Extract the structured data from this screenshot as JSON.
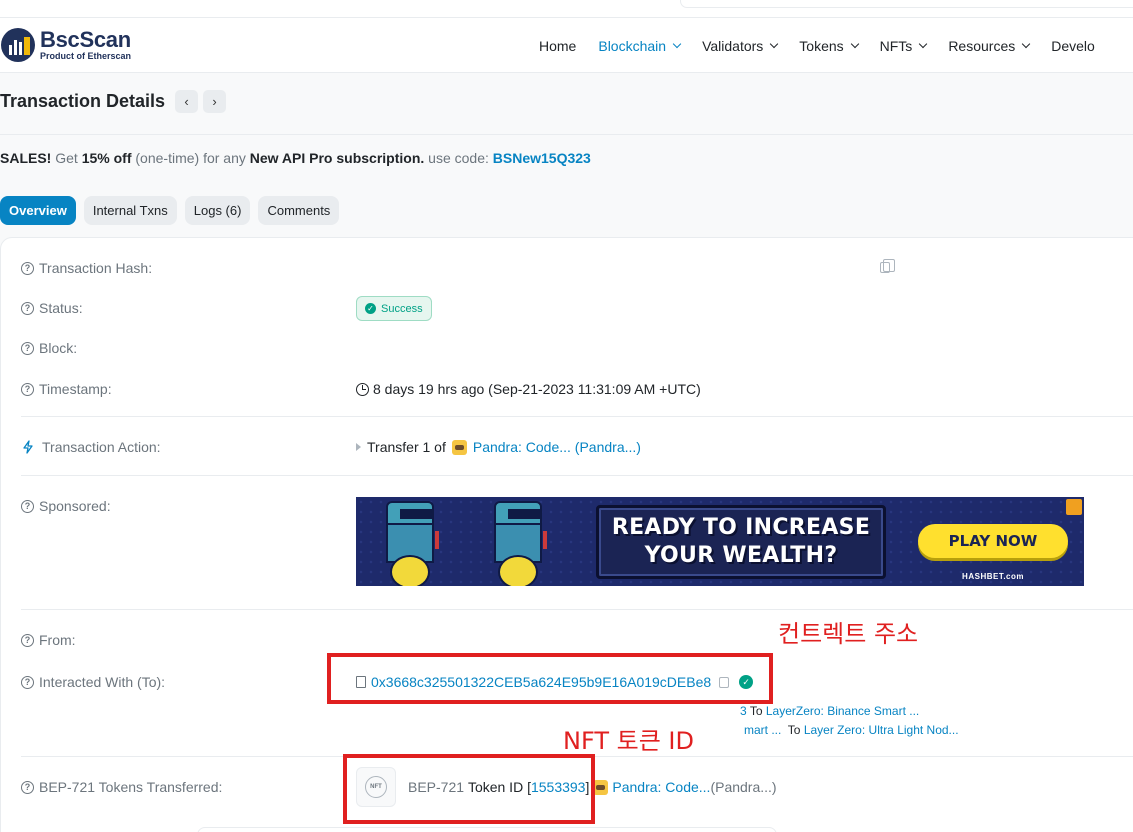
{
  "header": {
    "logo_name": "BscScan",
    "logo_sub": "Product of Etherscan",
    "nav": [
      {
        "label": "Home",
        "dropdown": false,
        "active": false
      },
      {
        "label": "Blockchain",
        "dropdown": true,
        "active": true
      },
      {
        "label": "Validators",
        "dropdown": true,
        "active": false
      },
      {
        "label": "Tokens",
        "dropdown": true,
        "active": false
      },
      {
        "label": "NFTs",
        "dropdown": true,
        "active": false
      },
      {
        "label": "Resources",
        "dropdown": true,
        "active": false
      },
      {
        "label": "Develo",
        "dropdown": false,
        "active": false
      }
    ]
  },
  "page": {
    "title": "Transaction Details",
    "prev_icon": "‹",
    "next_icon": "›"
  },
  "promo": {
    "p1": "SALES!",
    "p2": " Get ",
    "p3": "15% off",
    "p4": " (one-time) for any ",
    "p5": "New API Pro subscription.",
    "p6": " use code: ",
    "code": "BSNew15Q323"
  },
  "tabs": [
    {
      "label": "Overview",
      "active": true
    },
    {
      "label": "Internal Txns",
      "active": false
    },
    {
      "label": "Logs (6)",
      "active": false
    },
    {
      "label": "Comments",
      "active": false
    }
  ],
  "details": {
    "tx_hash_label": "Transaction Hash:",
    "status_label": "Status:",
    "status_value": "Success",
    "block_label": "Block:",
    "timestamp_label": "Timestamp:",
    "timestamp_value": "8 days 19 hrs ago (Sep-21-2023 11:31:09 AM +UTC)",
    "action_label": "Transaction Action:",
    "action_prefix": "Transfer 1 of",
    "action_token": "Pandra: Code... (Pandra...)",
    "sponsored_label": "Sponsored:",
    "from_label": "From:",
    "to_label": "Interacted With (To):",
    "to_address": "0x3668c325501322CEB5a624E95b9E16A019cDEBe8",
    "sub1_prefix": "3",
    "sub1_to": "To",
    "sub1_target": "LayerZero: Binance Smart ...",
    "sub2_prefix": "mart ...",
    "sub2_to": "To",
    "sub2_target": "Layer Zero: Ultra Light Nod...",
    "bep_label": "BEP-721 Tokens Transferred:",
    "bep_standard": "BEP-721",
    "bep_tokenid_label": "Token ID [",
    "bep_tokenid": "1553393",
    "bep_close": "]",
    "bep_token": "Pandra: Code...",
    "bep_token_suffix": "(Pandra...)",
    "nft_thumb_text": "NFT"
  },
  "banner": {
    "line1": "READY TO INCREASE",
    "line2": "YOUR WEALTH?",
    "cta": "PLAY NOW",
    "brand": "HASHBET.com"
  },
  "annotations": {
    "contract_address": "컨트렉트 주소",
    "nft_token_id": "NFT 토큰 ID"
  },
  "colors": {
    "link": "#0784c3",
    "success": "#00a186",
    "annotation_red": "#e02020",
    "brand_dark": "#21325b"
  }
}
